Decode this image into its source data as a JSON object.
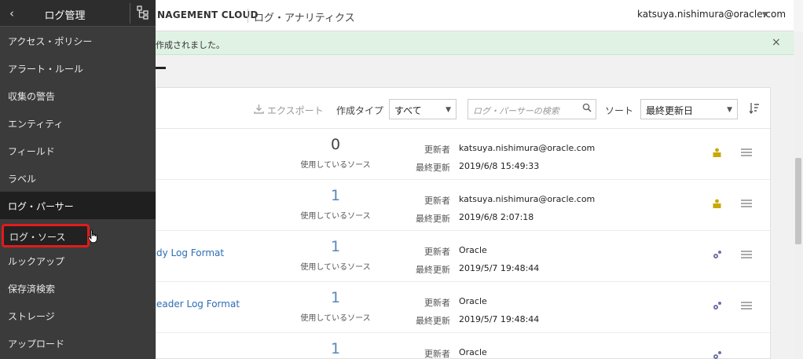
{
  "header": {
    "brand": "NAGEMENT CLOUD",
    "app_title": "ログ・アナリティクス",
    "user": "katsuya.nishimura@oracle.com",
    "user_caret": "▼"
  },
  "banner": {
    "text": "作成されました。",
    "close": "×"
  },
  "sidebar": {
    "back": "‹",
    "title": "ログ管理",
    "items": [
      {
        "label": "アクセス・ポリシー"
      },
      {
        "label": "アラート・ルール"
      },
      {
        "label": "収集の警告"
      },
      {
        "label": "エンティティ"
      },
      {
        "label": "フィールド"
      },
      {
        "label": "ラベル"
      },
      {
        "label": "ログ・パーサー"
      },
      {
        "label": "ログ・ソース"
      },
      {
        "label": "ルックアップ"
      },
      {
        "label": "保存済検索"
      },
      {
        "label": "ストレージ"
      },
      {
        "label": "アップロード"
      }
    ]
  },
  "toolbar": {
    "export_label": "エクスポート",
    "type_label": "作成タイプ",
    "type_value": "すべて",
    "search_placeholder": "ログ・パーサーの検索",
    "sort_label": "ソート",
    "sort_value": "最終更新日"
  },
  "rows": [
    {
      "name": "",
      "count": "0",
      "count_label": "使用しているソース",
      "updater_label": "更新者",
      "updater": "katsuya.nishimura@oracle.com",
      "updated_label": "最終更新",
      "updated": "2019/6/8 15:49:33",
      "icon": "owner-icon"
    },
    {
      "name": "",
      "count": "1",
      "count_label": "使用しているソース",
      "updater_label": "更新者",
      "updater": "katsuya.nishimura@oracle.com",
      "updated_label": "最終更新",
      "updated": "2019/6/8 2:07:18",
      "icon": "owner-icon"
    },
    {
      "name": "dy Log Format",
      "count": "1",
      "count_label": "使用しているソース",
      "updater_label": "更新者",
      "updater": "Oracle",
      "updated_label": "最終更新",
      "updated": "2019/5/7 19:48:44",
      "icon": "gear-icon"
    },
    {
      "name": "eader Log Format",
      "count": "1",
      "count_label": "使用しているソース",
      "updater_label": "更新者",
      "updater": "Oracle",
      "updated_label": "最終更新",
      "updated": "2019/5/7 19:48:44",
      "icon": "gear-icon"
    },
    {
      "name": "",
      "count": "1",
      "count_label": "",
      "updater_label": "更新者",
      "updater": "Oracle",
      "updated_label": "",
      "updated": "",
      "icon": "gear-icon"
    }
  ],
  "colors": {
    "sidebar_bg": "#3b3b3b",
    "banner_bg": "#dff2e4",
    "link": "#2c6db3",
    "highlight": "#e21b1b"
  }
}
